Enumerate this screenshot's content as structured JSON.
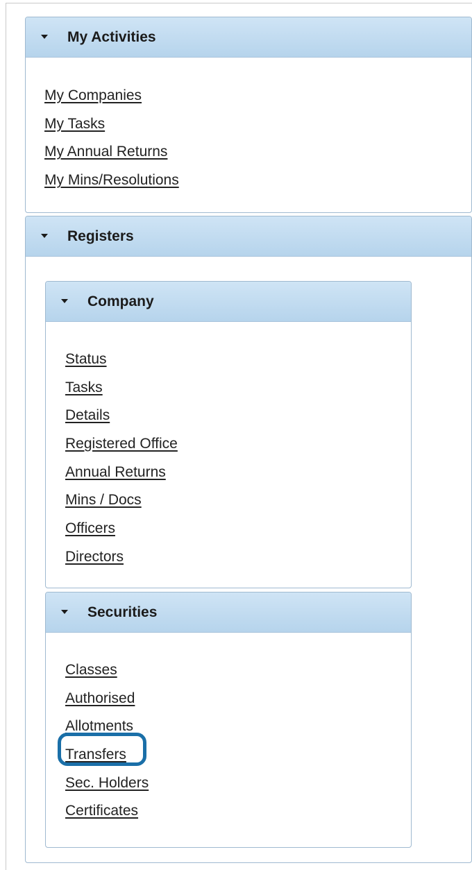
{
  "my_activities": {
    "title": "My Activities",
    "links": [
      "My Companies",
      "My Tasks",
      "My Annual Returns",
      "My Mins/Resolutions"
    ]
  },
  "registers": {
    "title": "Registers",
    "company": {
      "title": "Company",
      "links": [
        "Status",
        "Tasks",
        "Details",
        "Registered Office",
        "Annual Returns",
        "Mins / Docs",
        "Officers",
        "Directors"
      ]
    },
    "securities": {
      "title": "Securities",
      "links": [
        "Classes",
        "Authorised",
        "Allotments",
        "Transfers",
        "Sec. Holders",
        "Certificates"
      ]
    }
  },
  "highlighted_link": "Transfers",
  "icons": {
    "collapse": "caret-down-icon"
  },
  "colors": {
    "header_gradient_top": "#cfe4f5",
    "header_gradient_bottom": "#b6d4ec",
    "panel_border": "#9fb9d0",
    "highlight": "#1a6fa8"
  }
}
